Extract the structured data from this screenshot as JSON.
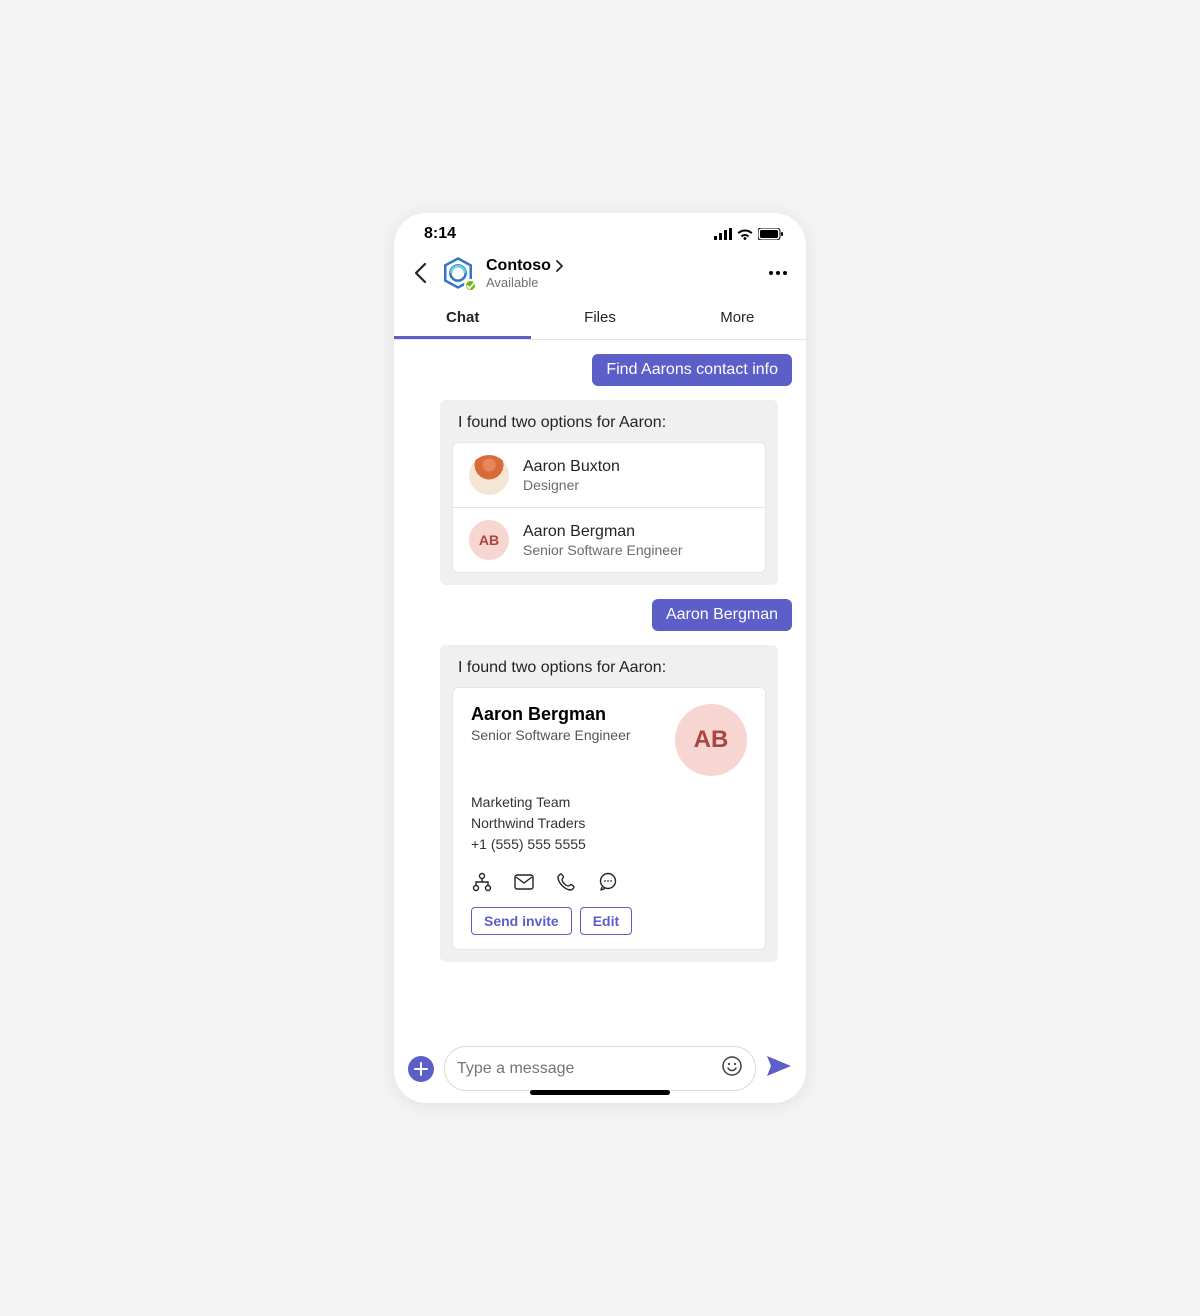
{
  "statusbar": {
    "time": "8:14"
  },
  "header": {
    "title": "Contoso",
    "status": "Available"
  },
  "tabs": [
    {
      "label": "Chat",
      "active": true
    },
    {
      "label": "Files",
      "active": false
    },
    {
      "label": "More",
      "active": false
    }
  ],
  "messages": {
    "user1": "Find Aarons contact info",
    "bot1": {
      "title": "I found two options for Aaron:",
      "options": [
        {
          "name": "Aaron Buxton",
          "role": "Designer",
          "initials": ""
        },
        {
          "name": "Aaron Bergman",
          "role": "Senior Software Engineer",
          "initials": "AB"
        }
      ]
    },
    "user2": "Aaron Bergman",
    "bot2": {
      "title": "I found two options for Aaron:",
      "card": {
        "name": "Aaron Bergman",
        "role": "Senior Software Engineer",
        "initials": "AB",
        "team": "Marketing Team",
        "company": "Northwind Traders",
        "phone": "+1 (555) 555 5555",
        "actions": {
          "invite": "Send invite",
          "edit": "Edit"
        }
      }
    }
  },
  "composer": {
    "placeholder": "Type a message"
  }
}
